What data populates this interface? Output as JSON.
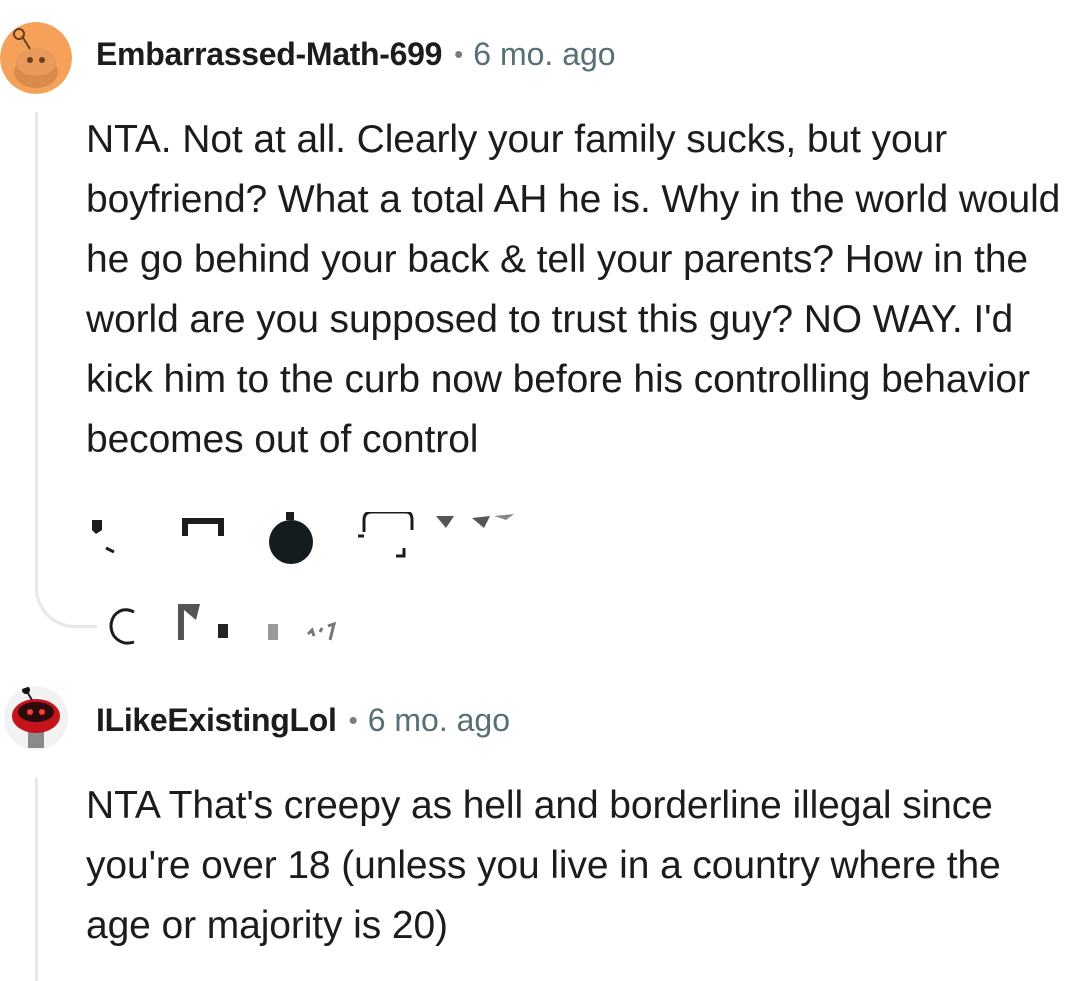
{
  "comments": [
    {
      "author": "Embarrassed-Math-699",
      "separator": "•",
      "time": "6 mo. ago",
      "body": "NTA. Not at all. Clearly your family sucks, but your boyfriend? What a total AH he is. Why in the world would he go behind your back & tell your parents? How in the world are you supposed to trust this guy? NO WAY. I'd kick him to the curb now before his controlling behavior becomes out of control",
      "avatar_color": "#f5a15a"
    },
    {
      "author": "ILikeExistingLol",
      "separator": "•",
      "time": "6 mo. ago",
      "body": "NTA That's creepy as hell and borderline illegal since you're over 18 (unless you live in a country where the age or majority is 20)",
      "avatar_color": "#c5121b"
    }
  ],
  "icons": {
    "action_row": [
      "upvote-icon",
      "downvote-icon",
      "award-icon",
      "comment-icon",
      "share-icon"
    ],
    "reply_row": [
      "reply-icon",
      "reply-label-icon"
    ]
  },
  "colors": {
    "thread_line": "#e5e7e8",
    "meta_time": "#576f76"
  }
}
